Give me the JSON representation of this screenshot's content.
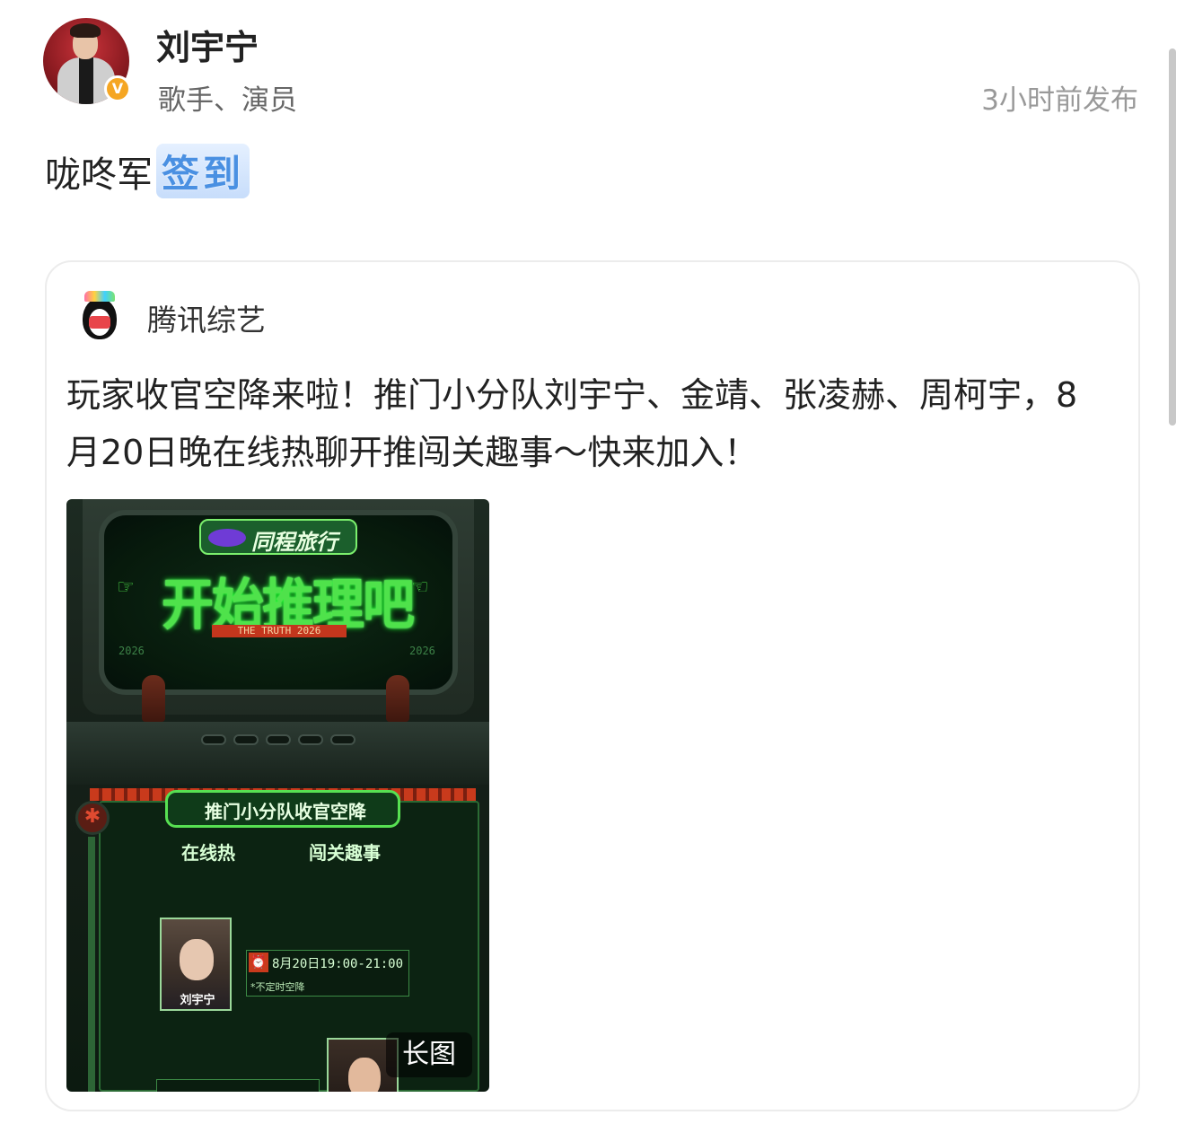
{
  "post": {
    "username": "刘宇宁",
    "user_desc": "歌手、演员",
    "time": "3小时前发布",
    "text": "咙咚军",
    "checkin_label": "签到"
  },
  "repost": {
    "source_name": "腾讯综艺",
    "text": "玩家收官空降来啦！推门小分队刘宇宁、金靖、张凌赫、周柯宇，8月20日晚在线热聊开推闯关趣事～快来加入！",
    "poster": {
      "brand": "同程旅行",
      "title": "开始推理吧",
      "subtitle": "THE TRUTH 2026",
      "year_left": "2026",
      "year_right": "2026",
      "tag": "推门小分队收官空降",
      "sub_left": "在线热",
      "sub_right": "闯关趣事",
      "person_name": "刘宇宁",
      "time_value": "8月20日19:00-21:00",
      "time_note": "*不定时空降",
      "long_badge": "长图"
    }
  },
  "icons": [
    "verified-icon",
    "tencent-variety-logo",
    "hand-point-icon",
    "star-icon",
    "clock-icon"
  ],
  "colors": {
    "checkin_blue": "#4a90e2",
    "verified_orange": "#f5a623",
    "poster_green": "#4fe24b"
  }
}
